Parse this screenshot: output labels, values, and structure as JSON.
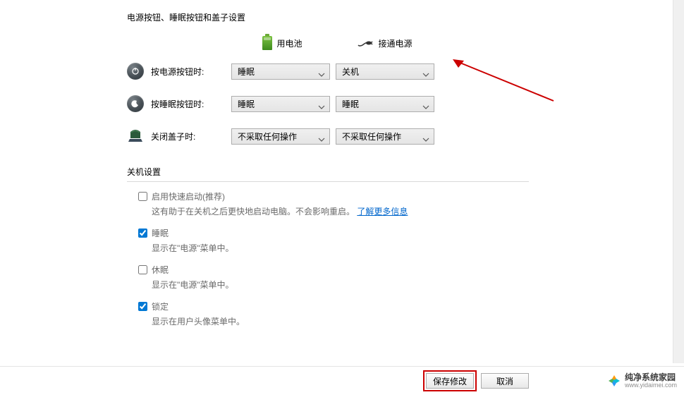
{
  "section_title": "电源按钮、睡眠按钮和盖子设置",
  "columns": {
    "battery": "用电池",
    "plugged": "接通电源"
  },
  "rows": {
    "power_button": {
      "label": "按电源按钮时:",
      "battery_value": "睡眠",
      "plugged_value": "关机"
    },
    "sleep_button": {
      "label": "按睡眠按钮时:",
      "battery_value": "睡眠",
      "plugged_value": "睡眠"
    },
    "lid_close": {
      "label": "关闭盖子时:",
      "battery_value": "不采取任何操作",
      "plugged_value": "不采取任何操作"
    }
  },
  "shutdown": {
    "title": "关机设置",
    "fast_startup": {
      "label": "启用快速启动(推荐)",
      "desc_prefix": "这有助于在关机之后更快地启动电脑。不会影响重启。",
      "link": "了解更多信息"
    },
    "sleep": {
      "label": "睡眠",
      "desc": "显示在\"电源\"菜单中。"
    },
    "hibernate": {
      "label": "休眠",
      "desc": "显示在\"电源\"菜单中。"
    },
    "lock": {
      "label": "锁定",
      "desc": "显示在用户头像菜单中。"
    }
  },
  "buttons": {
    "save": "保存修改",
    "cancel": "取消"
  },
  "watermark": {
    "name": "纯净系统家园",
    "url": "www.yidaimei.com"
  }
}
